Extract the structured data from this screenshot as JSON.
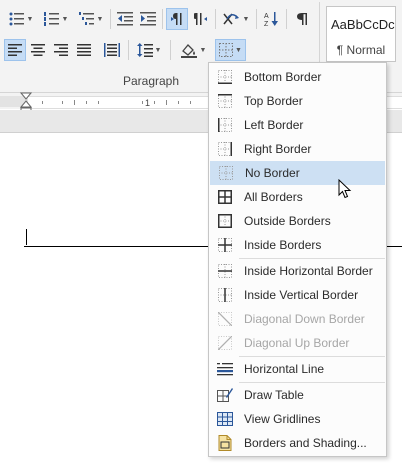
{
  "ribbon": {
    "group_label": "Paragraph",
    "icons": {
      "bullets": "bullets-icon",
      "numbering": "numbering-icon",
      "multilevel": "multilevel-list-icon",
      "decrease_indent": "decrease-indent-icon",
      "increase_indent": "increase-indent-icon",
      "ltr": "left-to-right-icon",
      "rtl": "right-to-left-icon",
      "asian_layout": "asian-layout-icon",
      "sort": "sort-icon",
      "show_marks": "show-marks-icon",
      "align_left": "align-left-icon",
      "center": "center-icon",
      "align_right": "align-right-icon",
      "justify": "justify-icon",
      "distributed": "distributed-icon",
      "line_spacing": "line-spacing-icon",
      "shading": "shading-icon",
      "borders": "borders-icon"
    },
    "styles": {
      "sample_text": "AaBbCcDc",
      "style_name": "¶ Normal"
    }
  },
  "ruler": {
    "marker_number": "1"
  },
  "menu": {
    "items": [
      {
        "label": "Bottom Border",
        "icon": "bottom-border-icon",
        "disabled": false
      },
      {
        "label": "Top Border",
        "icon": "top-border-icon",
        "disabled": false
      },
      {
        "label": "Left Border",
        "icon": "left-border-icon",
        "disabled": false
      },
      {
        "label": "Right Border",
        "icon": "right-border-icon",
        "disabled": false
      },
      {
        "label": "No Border",
        "icon": "no-border-icon",
        "disabled": false,
        "hovered": true
      },
      {
        "label": "All Borders",
        "icon": "all-borders-icon",
        "disabled": false
      },
      {
        "label": "Outside Borders",
        "icon": "outside-borders-icon",
        "disabled": false
      },
      {
        "label": "Inside Borders",
        "icon": "inside-borders-icon",
        "disabled": false
      },
      {
        "label": "Inside Horizontal Border",
        "icon": "inside-horizontal-border-icon",
        "disabled": false
      },
      {
        "label": "Inside Vertical Border",
        "icon": "inside-vertical-border-icon",
        "disabled": false
      },
      {
        "label": "Diagonal Down Border",
        "icon": "diagonal-down-border-icon",
        "disabled": true
      },
      {
        "label": "Diagonal Up Border",
        "icon": "diagonal-up-border-icon",
        "disabled": true
      },
      {
        "label": "Horizontal Line",
        "icon": "horizontal-line-icon",
        "disabled": false
      },
      {
        "label": "Draw Table",
        "icon": "draw-table-icon",
        "disabled": false
      },
      {
        "label": "View Gridlines",
        "icon": "view-gridlines-icon",
        "disabled": false
      },
      {
        "label": "Borders and Shading...",
        "icon": "borders-and-shading-icon",
        "disabled": false
      }
    ]
  },
  "colors": {
    "accent_hover": "#cde0f3",
    "active_button": "#c5dcf5",
    "ribbon_bg": "#f3f3f3"
  }
}
